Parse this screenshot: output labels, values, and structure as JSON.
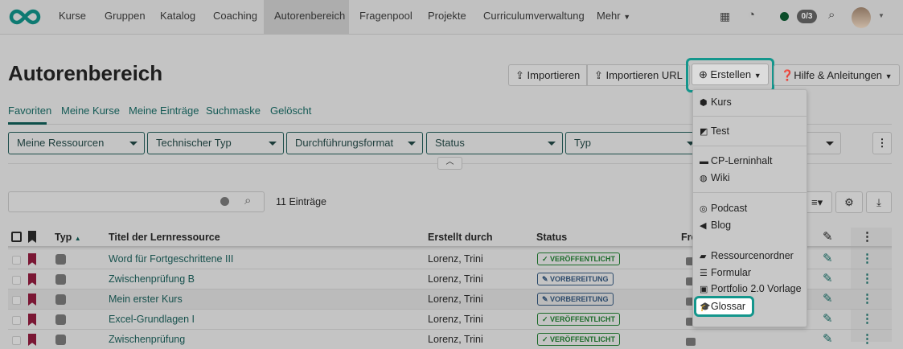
{
  "nav": {
    "items": [
      "Kurse",
      "Gruppen",
      "Katalog",
      "Coaching",
      "Autorenbereich",
      "Fragenpool",
      "Projekte",
      "Curriculumverwaltung",
      "Mehr"
    ],
    "active": "Autorenbereich",
    "badge": "0/3"
  },
  "page": {
    "title": "Autorenbereich"
  },
  "toolbar": {
    "import": "Importieren",
    "import_url": "Importieren URL",
    "create": "Erstellen",
    "help": "Hilfe & Anleitungen"
  },
  "tabs": [
    "Favoriten",
    "Meine Kurse",
    "Meine Einträge",
    "Suchmaske",
    "Gelöscht"
  ],
  "filters": [
    "Meine Ressourcen",
    "Technischer Typ",
    "Durchführungsformat",
    "Status",
    "Typ"
  ],
  "search": {
    "value": "",
    "count": "11 Einträge"
  },
  "table": {
    "headers": {
      "type": "Typ",
      "title": "Titel der Lernressource",
      "author": "Erstellt durch",
      "status": "Status",
      "fre": "Fre"
    },
    "rows": [
      {
        "title": "Word für Fortgeschrittene III",
        "author": "Lorenz, Trini",
        "status": "VERÖFFENTLICHT",
        "kind": "pub",
        "extra": ""
      },
      {
        "title": "Zwischenprüfung B",
        "author": "Lorenz, Trini",
        "status": "VORBEREITUNG",
        "kind": "prep",
        "extra": ""
      },
      {
        "title": "Mein erster Kurs",
        "author": "Lorenz, Trini",
        "status": "VORBEREITUNG",
        "kind": "prep",
        "extra": ""
      },
      {
        "title": "Excel-Grundlagen I",
        "author": "Lorenz, Trini",
        "status": "VERÖFFENTLICHT",
        "kind": "pub",
        "extra": "1"
      },
      {
        "title": "Zwischenprüfung",
        "author": "Lorenz, Trini",
        "status": "VERÖFFENTLICHT",
        "kind": "pub",
        "extra": ""
      }
    ]
  },
  "menu": {
    "items": [
      "Kurs",
      "Test",
      "CP-Lerninhalt",
      "Wiki",
      "Podcast",
      "Blog",
      "Ressourcenordner",
      "Formular",
      "Portfolio 2.0 Vorlage",
      "Glossar"
    ],
    "highlighted": "Glossar"
  },
  "colors": {
    "accent": "#14968c",
    "brand": "#0e7a72",
    "published": "#1c6b2a",
    "preparation": "#2c4a6b",
    "bookmark": "#7a1734"
  }
}
